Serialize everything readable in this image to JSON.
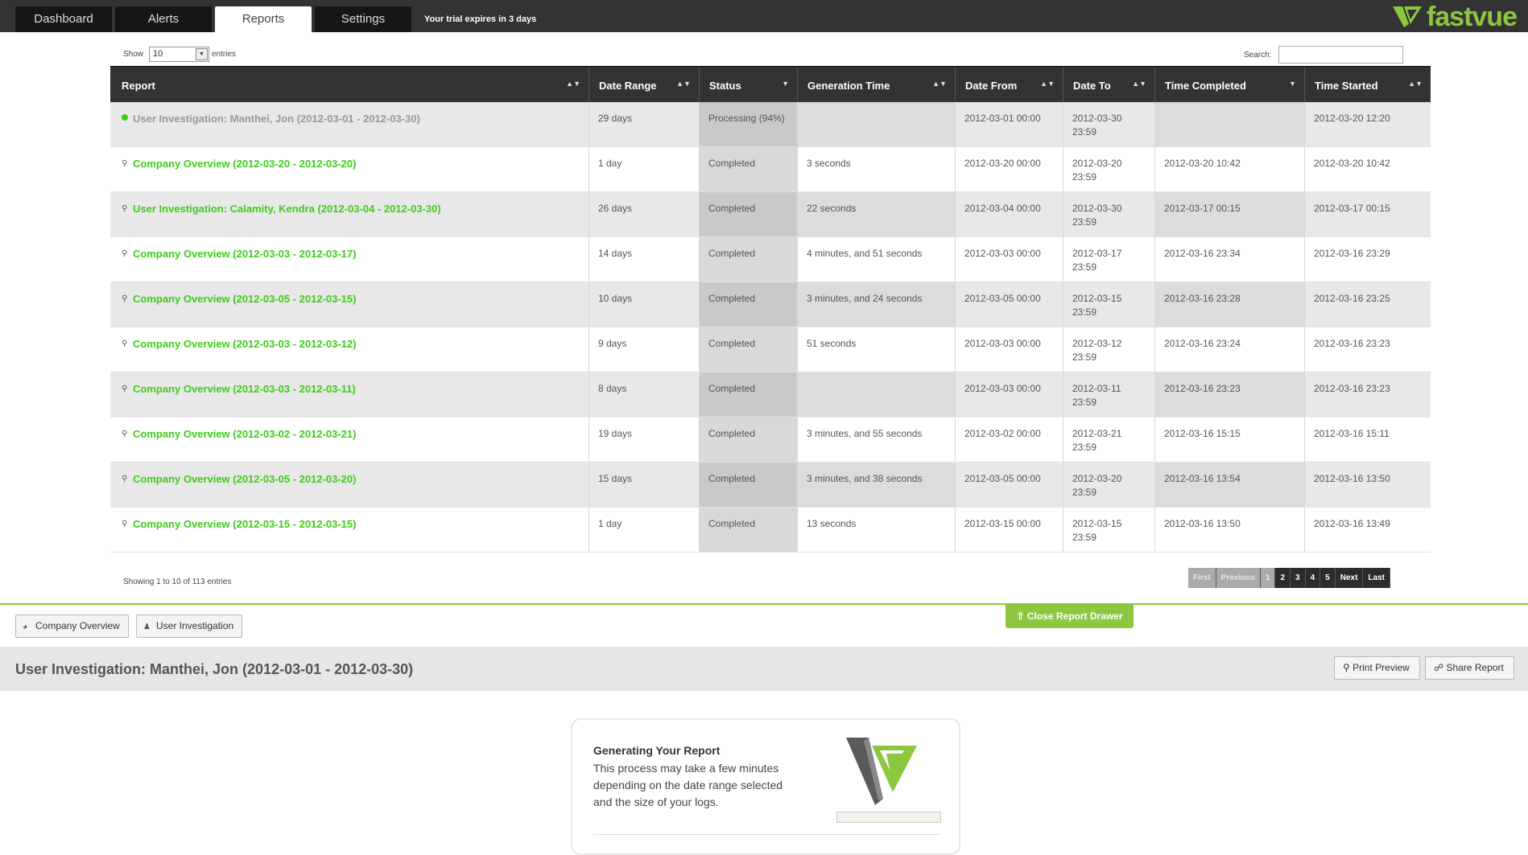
{
  "nav": {
    "tabs": [
      {
        "label": "Dashboard"
      },
      {
        "label": "Alerts"
      },
      {
        "label": "Reports"
      },
      {
        "label": "Settings"
      }
    ],
    "trial_text": "Your trial expires in 3 days",
    "logo_text": "fastvue"
  },
  "controls": {
    "show_label": "Show",
    "show_value": "10",
    "entries_label": "entries",
    "search_label": "Search:",
    "search_value": ""
  },
  "table": {
    "headers": [
      "Report",
      "Date Range",
      "Status",
      "Generation Time",
      "Date From",
      "Date To",
      "Time Completed",
      "Time Started"
    ],
    "rows": [
      {
        "report": "User Investigation: Manthei, Jon (2012-03-01 - 2012-03-30)",
        "range": "29 days",
        "status": "Processing (94%)",
        "gen": "",
        "from": "2012-03-01 00:00",
        "to": "2012-03-30 23:59",
        "completed": "",
        "started": "2012-03-20 12:20"
      },
      {
        "report": "Company Overview (2012-03-20 - 2012-03-20)",
        "range": "1 day",
        "status": "Completed",
        "gen": "3 seconds",
        "from": "2012-03-20 00:00",
        "to": "2012-03-20 23:59",
        "completed": "2012-03-20 10:42",
        "started": "2012-03-20 10:42"
      },
      {
        "report": "User Investigation: Calamity, Kendra (2012-03-04 - 2012-03-30)",
        "range": "26 days",
        "status": "Completed",
        "gen": "22 seconds",
        "from": "2012-03-04 00:00",
        "to": "2012-03-30 23:59",
        "completed": "2012-03-17 00:15",
        "started": "2012-03-17 00:15"
      },
      {
        "report": "Company Overview (2012-03-03 - 2012-03-17)",
        "range": "14 days",
        "status": "Completed",
        "gen": "4 minutes, and 51 seconds",
        "from": "2012-03-03 00:00",
        "to": "2012-03-17 23:59",
        "completed": "2012-03-16 23:34",
        "started": "2012-03-16 23:29"
      },
      {
        "report": "Company Overview (2012-03-05 - 2012-03-15)",
        "range": "10 days",
        "status": "Completed",
        "gen": "3 minutes, and 24 seconds",
        "from": "2012-03-05 00:00",
        "to": "2012-03-15 23:59",
        "completed": "2012-03-16 23:28",
        "started": "2012-03-16 23:25"
      },
      {
        "report": "Company Overview (2012-03-03 - 2012-03-12)",
        "range": "9 days",
        "status": "Completed",
        "gen": "51 seconds",
        "from": "2012-03-03 00:00",
        "to": "2012-03-12 23:59",
        "completed": "2012-03-16 23:24",
        "started": "2012-03-16 23:23"
      },
      {
        "report": "Company Overview (2012-03-03 - 2012-03-11)",
        "range": "8 days",
        "status": "Completed",
        "gen": "",
        "from": "2012-03-03 00:00",
        "to": "2012-03-11 23:59",
        "completed": "2012-03-16 23:23",
        "started": "2012-03-16 23:23"
      },
      {
        "report": "Company Overview (2012-03-02 - 2012-03-21)",
        "range": "19 days",
        "status": "Completed",
        "gen": "3 minutes, and 55 seconds",
        "from": "2012-03-02 00:00",
        "to": "2012-03-21 23:59",
        "completed": "2012-03-16 15:15",
        "started": "2012-03-16 15:11"
      },
      {
        "report": "Company Overview (2012-03-05 - 2012-03-20)",
        "range": "15 days",
        "status": "Completed",
        "gen": "3 minutes, and 38 seconds",
        "from": "2012-03-05 00:00",
        "to": "2012-03-20 23:59",
        "completed": "2012-03-16 13:54",
        "started": "2012-03-16 13:50"
      },
      {
        "report": "Company Overview (2012-03-15 - 2012-03-15)",
        "range": "1 day",
        "status": "Completed",
        "gen": "13 seconds",
        "from": "2012-03-15 00:00",
        "to": "2012-03-15 23:59",
        "completed": "2012-03-16 13:50",
        "started": "2012-03-16 13:49"
      }
    ],
    "info": "Showing 1 to 10 of 113 entries"
  },
  "pager": {
    "first": "First",
    "previous": "Previous",
    "pages": [
      "1",
      "2",
      "3",
      "4",
      "5"
    ],
    "next": "Next",
    "last": "Last"
  },
  "drawer": {
    "company_overview": "Company Overview",
    "user_investigation": "User Investigation",
    "close": "Close Report Drawer"
  },
  "report": {
    "title": "User Investigation: Manthei, Jon (2012-03-01 - 2012-03-30)",
    "print_preview": "Print Preview",
    "share_report": "Share Report",
    "gen_title": "Generating Your Report",
    "gen_text": "This process may take a few minutes depending on the date range selected and the size of your logs."
  },
  "colors": {
    "accent": "#8dc63f",
    "link": "#3ecc1a",
    "nav_bg": "#333333"
  }
}
